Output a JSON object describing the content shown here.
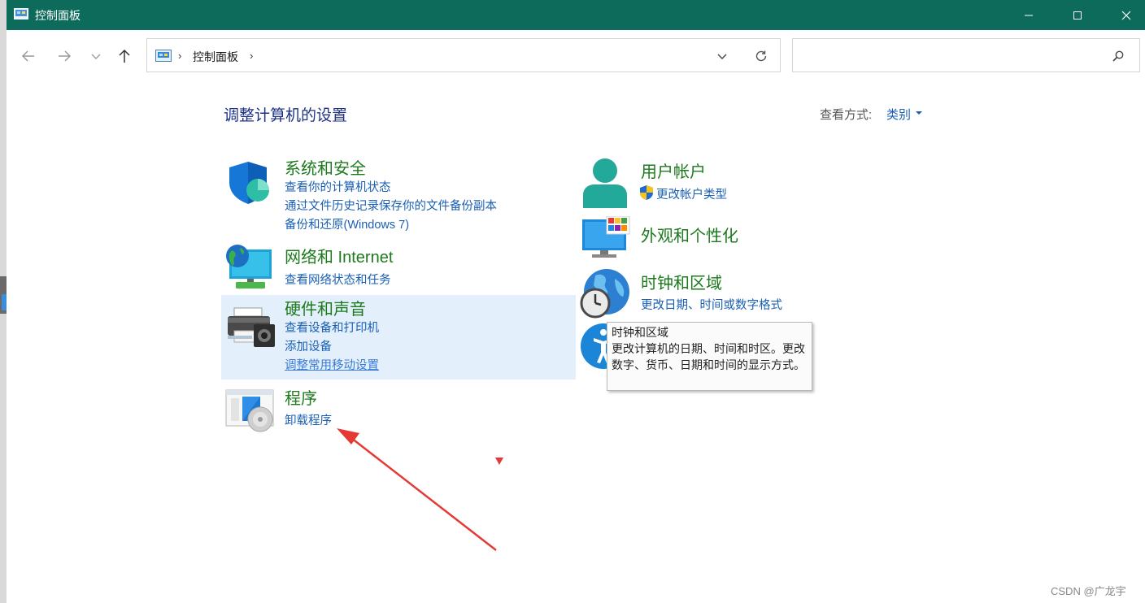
{
  "window": {
    "title": "控制面板"
  },
  "address": {
    "crumb": "控制面板",
    "sep1": "›",
    "sep2": "›"
  },
  "search": {
    "placeholder": ""
  },
  "page": {
    "heading": "调整计算机的设置",
    "view_by_label": "查看方式:",
    "view_by_value": "类别"
  },
  "categories": [
    {
      "title": "系统和安全",
      "links": [
        "查看你的计算机状态",
        "通过文件历史记录保存你的文件备份副本",
        "备份和还原(Windows 7)"
      ]
    },
    {
      "title": "网络和 Internet",
      "links": [
        "查看网络状态和任务"
      ]
    },
    {
      "title": "硬件和声音",
      "links": [
        "查看设备和打印机",
        "添加设备",
        "调整常用移动设置"
      ]
    },
    {
      "title": "程序",
      "links": [
        "卸载程序"
      ]
    },
    {
      "title": "用户帐户",
      "links": [
        "更改帐户类型"
      ]
    },
    {
      "title": "外观和个性化",
      "links": []
    },
    {
      "title": "时钟和区域",
      "links": [
        "更改日期、时间或数字格式"
      ]
    }
  ],
  "tooltip": {
    "title": "时钟和区域",
    "body": "更改计算机的日期、时间和时区。更改数字、货币、日期和时间的显示方式。"
  },
  "watermark": "CSDN @广龙宇",
  "colors": {
    "titlebar": "#0d6b5c",
    "link": "#1a5fb4",
    "category_title": "#1d7a1d",
    "heading": "#1e3287",
    "hover_bg": "#e3f0fb",
    "annotation": "#e53935"
  }
}
